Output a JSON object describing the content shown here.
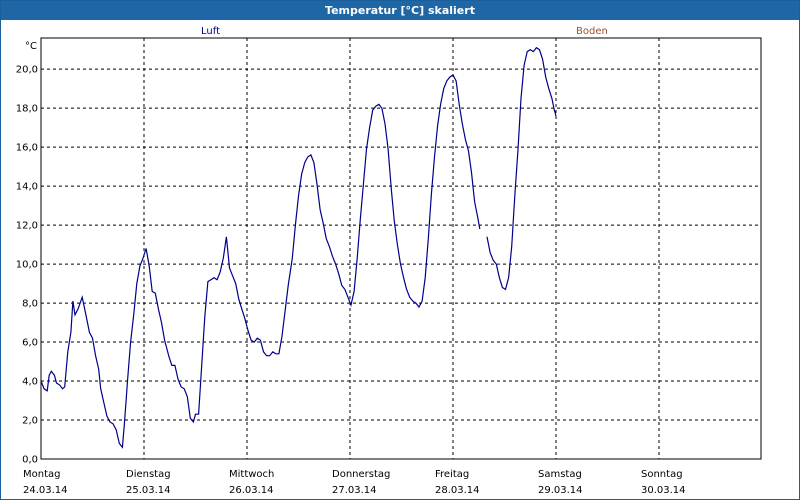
{
  "window": {
    "title": "Temperatur [°C] skaliert"
  },
  "chart_data": {
    "type": "line",
    "title": "Temperatur [°C] skaliert",
    "ylabel": "°C",
    "ylim": [
      0,
      21.6
    ],
    "yticks": [
      "0,0",
      "2,0",
      "4,0",
      "6,0",
      "8,0",
      "10,0",
      "12,0",
      "14,0",
      "16,0",
      "18,0",
      "20,0"
    ],
    "x_unit": "days since 24.03.14 00:00",
    "xlim": [
      0,
      7
    ],
    "x_labels": [
      {
        "day": "Montag",
        "date": "24.03.14"
      },
      {
        "day": "Dienstag",
        "date": "25.03.14"
      },
      {
        "day": "Mittwoch",
        "date": "26.03.14"
      },
      {
        "day": "Donnerstag",
        "date": "27.03.14"
      },
      {
        "day": "Freitag",
        "date": "28.03.14"
      },
      {
        "day": "Samstag",
        "date": "29.03.14"
      },
      {
        "day": "Sonntag",
        "date": "30.03.14"
      }
    ],
    "grid": true,
    "legend": [
      {
        "name": "Luft",
        "color": "#00008b"
      },
      {
        "name": "Boden",
        "color": "#a0522d"
      }
    ],
    "series": [
      {
        "name": "Luft",
        "color": "#00008b",
        "segments": [
          [
            [
              0.0,
              4.0
            ],
            [
              0.03,
              3.6
            ],
            [
              0.06,
              3.5
            ],
            [
              0.08,
              4.3
            ],
            [
              0.1,
              4.5
            ],
            [
              0.13,
              4.3
            ],
            [
              0.15,
              3.9
            ],
            [
              0.18,
              3.8
            ],
            [
              0.21,
              3.6
            ],
            [
              0.23,
              3.7
            ],
            [
              0.26,
              5.5
            ],
            [
              0.29,
              6.5
            ],
            [
              0.31,
              8.1
            ],
            [
              0.33,
              7.4
            ],
            [
              0.36,
              7.7
            ],
            [
              0.4,
              8.3
            ],
            [
              0.44,
              7.3
            ],
            [
              0.47,
              6.5
            ],
            [
              0.5,
              6.2
            ],
            [
              0.53,
              5.3
            ],
            [
              0.56,
              4.6
            ],
            [
              0.58,
              3.6
            ],
            [
              0.61,
              2.9
            ],
            [
              0.64,
              2.2
            ],
            [
              0.67,
              1.9
            ],
            [
              0.7,
              1.8
            ],
            [
              0.73,
              1.5
            ],
            [
              0.76,
              0.8
            ],
            [
              0.79,
              0.6
            ],
            [
              0.81,
              1.8
            ],
            [
              0.84,
              4.0
            ],
            [
              0.87,
              6.0
            ],
            [
              0.9,
              7.4
            ],
            [
              0.93,
              9.0
            ],
            [
              0.96,
              9.9
            ],
            [
              0.99,
              10.3
            ],
            [
              1.02,
              10.8
            ],
            [
              1.05,
              9.9
            ],
            [
              1.08,
              8.6
            ],
            [
              1.11,
              8.5
            ],
            [
              1.14,
              7.7
            ],
            [
              1.17,
              7.0
            ],
            [
              1.2,
              6.1
            ],
            [
              1.24,
              5.3
            ],
            [
              1.27,
              4.8
            ],
            [
              1.3,
              4.8
            ],
            [
              1.33,
              4.1
            ],
            [
              1.36,
              3.7
            ],
            [
              1.39,
              3.6
            ],
            [
              1.42,
              3.2
            ],
            [
              1.45,
              2.1
            ],
            [
              1.48,
              1.9
            ],
            [
              1.5,
              2.3
            ],
            [
              1.53,
              2.3
            ],
            [
              1.56,
              4.8
            ],
            [
              1.59,
              7.3
            ],
            [
              1.62,
              9.1
            ],
            [
              1.65,
              9.2
            ],
            [
              1.68,
              9.3
            ],
            [
              1.71,
              9.2
            ],
            [
              1.74,
              9.6
            ],
            [
              1.77,
              10.3
            ],
            [
              1.8,
              11.4
            ],
            [
              1.83,
              9.8
            ],
            [
              1.86,
              9.4
            ],
            [
              1.89,
              9.0
            ],
            [
              1.92,
              8.2
            ],
            [
              1.95,
              7.7
            ],
            [
              1.98,
              7.2
            ],
            [
              2.01,
              6.6
            ],
            [
              2.04,
              6.1
            ],
            [
              2.07,
              6.0
            ],
            [
              2.1,
              6.2
            ],
            [
              2.13,
              6.1
            ],
            [
              2.16,
              5.5
            ],
            [
              2.19,
              5.3
            ],
            [
              2.22,
              5.3
            ],
            [
              2.25,
              5.5
            ],
            [
              2.28,
              5.4
            ],
            [
              2.31,
              5.4
            ],
            [
              2.34,
              6.3
            ],
            [
              2.37,
              7.6
            ],
            [
              2.4,
              8.9
            ],
            [
              2.44,
              10.3
            ],
            [
              2.47,
              12.0
            ],
            [
              2.5,
              13.5
            ],
            [
              2.53,
              14.6
            ],
            [
              2.56,
              15.2
            ],
            [
              2.59,
              15.5
            ],
            [
              2.62,
              15.6
            ],
            [
              2.65,
              15.2
            ],
            [
              2.68,
              14.1
            ],
            [
              2.71,
              12.8
            ],
            [
              2.74,
              12.1
            ],
            [
              2.77,
              11.3
            ],
            [
              2.8,
              10.9
            ],
            [
              2.83,
              10.4
            ],
            [
              2.86,
              10.0
            ],
            [
              2.89,
              9.5
            ],
            [
              2.92,
              8.9
            ],
            [
              2.95,
              8.7
            ],
            [
              2.98,
              8.3
            ],
            [
              3.01,
              7.9
            ],
            [
              3.04,
              8.6
            ],
            [
              3.07,
              10.3
            ],
            [
              3.1,
              12.3
            ],
            [
              3.13,
              14.1
            ],
            [
              3.16,
              15.9
            ],
            [
              3.19,
              17.0
            ],
            [
              3.22,
              17.9
            ],
            [
              3.25,
              18.1
            ],
            [
              3.28,
              18.2
            ],
            [
              3.31,
              18.0
            ],
            [
              3.34,
              17.2
            ],
            [
              3.37,
              15.9
            ],
            [
              3.4,
              13.9
            ],
            [
              3.43,
              12.2
            ],
            [
              3.46,
              11.0
            ],
            [
              3.49,
              10.0
            ],
            [
              3.52,
              9.3
            ],
            [
              3.55,
              8.7
            ],
            [
              3.58,
              8.3
            ],
            [
              3.61,
              8.1
            ],
            [
              3.64,
              8.0
            ],
            [
              3.67,
              7.8
            ],
            [
              3.7,
              8.1
            ],
            [
              3.73,
              9.3
            ],
            [
              3.76,
              11.3
            ],
            [
              3.79,
              13.6
            ],
            [
              3.82,
              15.5
            ],
            [
              3.85,
              17.1
            ],
            [
              3.88,
              18.2
            ],
            [
              3.91,
              19.0
            ],
            [
              3.94,
              19.4
            ],
            [
              3.97,
              19.6
            ],
            [
              4.0,
              19.7
            ],
            [
              4.03,
              19.4
            ],
            [
              4.06,
              18.2
            ],
            [
              4.09,
              17.2
            ],
            [
              4.12,
              16.4
            ],
            [
              4.15,
              15.8
            ],
            [
              4.18,
              14.7
            ],
            [
              4.21,
              13.2
            ],
            [
              4.24,
              12.4
            ],
            [
              4.26,
              11.8
            ]
          ],
          [
            [
              4.33,
              11.4
            ],
            [
              4.36,
              10.6
            ],
            [
              4.39,
              10.2
            ],
            [
              4.42,
              10.0
            ],
            [
              4.45,
              9.3
            ],
            [
              4.48,
              8.8
            ],
            [
              4.51,
              8.7
            ],
            [
              4.54,
              9.3
            ],
            [
              4.57,
              10.9
            ],
            [
              4.6,
              13.5
            ],
            [
              4.63,
              15.8
            ],
            [
              4.66,
              18.5
            ],
            [
              4.69,
              20.2
            ],
            [
              4.72,
              20.9
            ],
            [
              4.75,
              21.0
            ],
            [
              4.78,
              20.9
            ],
            [
              4.81,
              21.1
            ],
            [
              4.84,
              21.0
            ],
            [
              4.87,
              20.5
            ],
            [
              4.9,
              19.6
            ],
            [
              4.93,
              19.0
            ],
            [
              4.96,
              18.5
            ],
            [
              4.98,
              18.0
            ],
            [
              5.0,
              17.6
            ]
          ]
        ]
      }
    ]
  }
}
